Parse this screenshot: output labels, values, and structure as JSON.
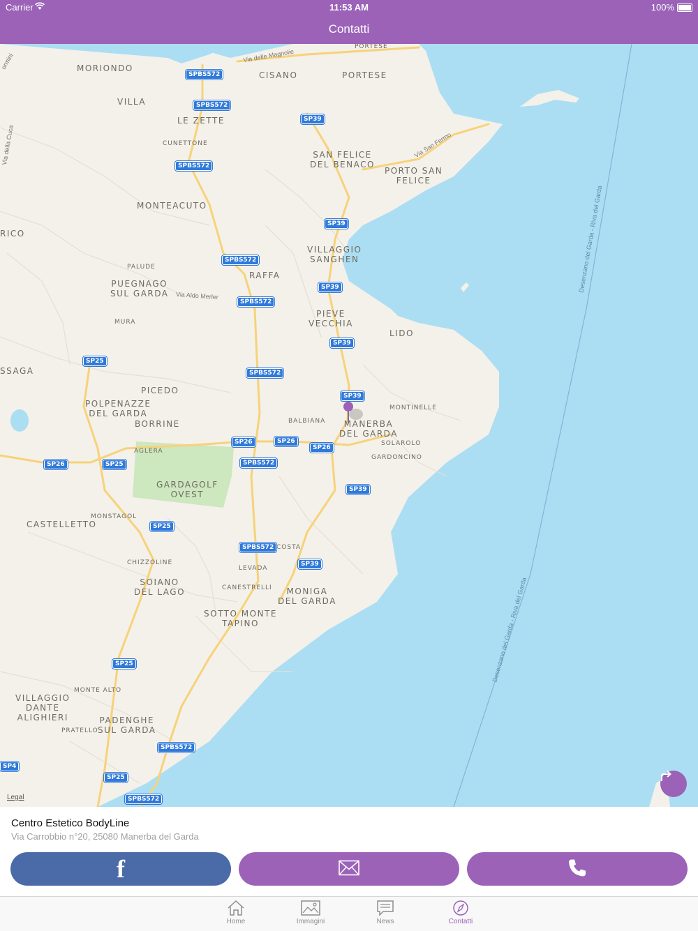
{
  "status": {
    "carrier": "Carrier",
    "time": "11:53 AM",
    "battery": "100%"
  },
  "nav": {
    "title": "Contatti"
  },
  "map": {
    "legal": "Legal",
    "places": {
      "moriondo": "MORIONDO",
      "villa": "VILLA",
      "lezette": "LE ZETTE",
      "cunettone": "CUNETTONE",
      "cisano": "CISANO",
      "portese": "PORTESE",
      "portese2": "PORTESE",
      "sanfelice": "SAN FELICE\nDEL BENACO",
      "portosanfelice": "PORTO SAN\nFELICE",
      "monteacuto": "MONTEACUTO",
      "rico": "RICO",
      "villaggio": "VILLAGGIO\nSANGHEN",
      "raffa": "RAFFA",
      "palude": "PALUDE",
      "puegnago": "PUEGNAGO\nSUL GARDA",
      "mura": "MURA",
      "pieve": "PIEVE\nVECCHIA",
      "lido": "LIDO",
      "ssaga": "SSAGA",
      "picedo": "PICEDO",
      "polpenazze": "POLPENAZZE\nDEL GARDA",
      "borrine": "BORRINE",
      "balbiana": "BALBIANA",
      "montinelle": "MONTINELLE",
      "manerba": "MANERBA\nDEL GARDA",
      "solarolo": "SOLAROLO",
      "gardoncino": "GARDONCINO",
      "aglera": "AGLERA",
      "gardagolf": "GARDAGOLF\nOVEST",
      "castelletto": "CASTELLETTO",
      "monstagol": "MONSTAGOL",
      "chizzoline": "CHIZZOLINE",
      "costa": "COSTA",
      "levada": "LEVADA",
      "soiano": "SOIANO\nDEL LAGO",
      "canestrelli": "CANESTRELLI",
      "moniga": "MONIGA\nDEL GARDA",
      "sotto": "SOTTO MONTE\nTAPINO",
      "monte": "MONTE ALTO",
      "villaggiodante": "VILLAGGIO\nDANTE\nALIGHIERI",
      "pratello": "PRATELLO",
      "padenghe": "PADENGHE\nSUL GARDA",
      "ormini": "ormini"
    },
    "streets": {
      "magnolie": "Via delle Magnolie",
      "sanfermo": "Via San Fermo",
      "aldo": "Via Aldo Merler",
      "cuca": "Via della Cuca",
      "ferry1": "Desenzano del Garda - Riva del Garda",
      "ferry2": "Desenzano del Garda - Riva del Garda"
    },
    "roads": {
      "r1": "SPBS572",
      "r2": "SPBS572",
      "r3": "SP39",
      "r4": "SPBS572",
      "r5": "SP39",
      "r6": "SPBS572",
      "r7": "SP39",
      "r8": "SPBS572",
      "r9": "SP39",
      "r10": "SP25",
      "r11": "SPBS572",
      "r12": "SP39",
      "r13": "SP26",
      "r14": "SP26",
      "r15": "SP26",
      "r16": "SPBS572",
      "r17": "SP26",
      "r18": "SP25",
      "r19": "SP39",
      "r20": "SP25",
      "r21": "SPBS572",
      "r22": "SP39",
      "r23": "SP25",
      "r24": "SPBS572",
      "r25": "SP4",
      "r26": "SP25",
      "r27": "SPBS572"
    }
  },
  "business": {
    "name": "Centro Estetico BodyLine",
    "address": "Via Carrobbio n°20, 25080 Manerba del Garda"
  },
  "buttons": {
    "facebook": "f"
  },
  "tabs": [
    {
      "label": "Home"
    },
    {
      "label": "Immagini"
    },
    {
      "label": "News"
    },
    {
      "label": "Contatti"
    }
  ],
  "colors": {
    "accent": "#9b62b8",
    "facebook": "#4a6aa8",
    "water": "#abdef3",
    "land": "#f4f1ea",
    "road": "#f7d27a"
  }
}
